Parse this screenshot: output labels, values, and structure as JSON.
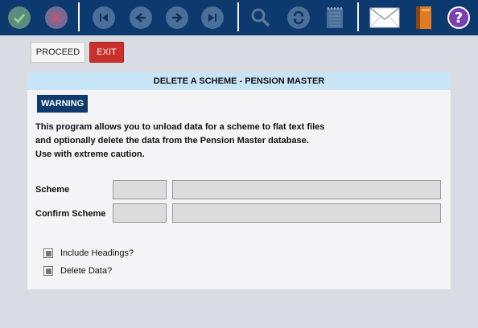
{
  "toolbar": {
    "icons": [
      "checkmark-icon",
      "cancel-icon",
      "first-record-icon",
      "previous-record-icon",
      "next-record-icon",
      "last-record-icon",
      "search-icon",
      "refresh-icon",
      "notepad-icon",
      "mail-icon",
      "book-icon",
      "help-icon"
    ],
    "help_glyph": "?"
  },
  "actions": {
    "proceed_label": "PROCEED",
    "exit_label": "EXIT"
  },
  "panel": {
    "title": "DELETE A SCHEME - PENSION MASTER",
    "warning_label": "WARNING",
    "description_lines": [
      "This program allows you to unload data for a scheme to flat text files",
      "and optionally delete the data from the Pension Master database.",
      "Use with extreme caution."
    ]
  },
  "form": {
    "scheme_label": "Scheme",
    "confirm_scheme_label": "Confirm Scheme",
    "scheme_code_value": "",
    "scheme_name_value": "",
    "confirm_code_value": "",
    "confirm_name_value": ""
  },
  "options": {
    "include_headings_label": "Include Headings?",
    "delete_data_label": "Delete Data?"
  },
  "colors": {
    "toolbar_bg": "#0d3a6e",
    "header_bg": "#c8e5f8",
    "exit_bg": "#c9302c",
    "page_bg": "#d9dde3"
  }
}
